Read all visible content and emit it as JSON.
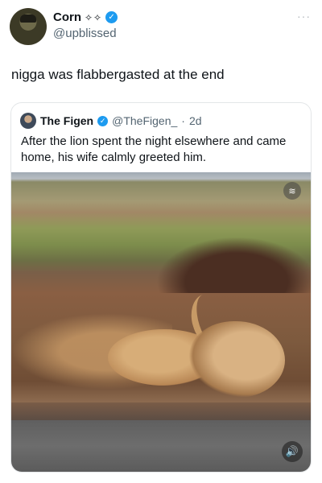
{
  "author": {
    "name": "Corn",
    "name_decoration": "✧✧",
    "handle": "@upblissed",
    "verified_icon": "verified-badge-icon"
  },
  "tweet": {
    "text": "nigga was flabbergasted at the end"
  },
  "more_menu": "···",
  "quoted": {
    "name": "The Figen",
    "handle": "@TheFigen_",
    "separator": "·",
    "age": "2d",
    "text": "After the lion spent the night elsewhere and came home, his wife calmly greeted him."
  },
  "media": {
    "kind": "video",
    "sound_icon": "speaker-icon",
    "watermark_icon": "watermark-icon"
  },
  "colors": {
    "verified": "#1d9bf0",
    "secondary_text": "#536471",
    "border": "#e3e6e8"
  }
}
